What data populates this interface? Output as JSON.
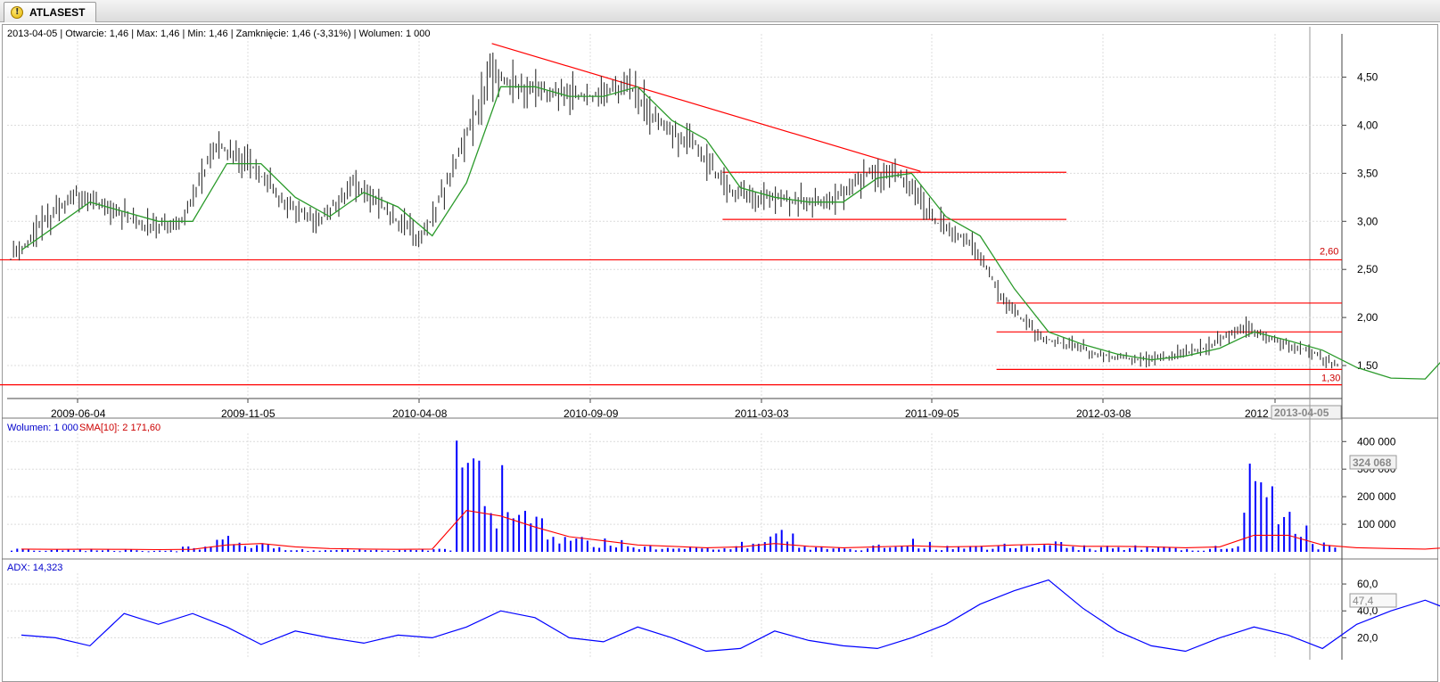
{
  "tab": {
    "title": "ATLASEST"
  },
  "info": {
    "ohlc": "2013-04-05 | Otwarcie: 1,46 | Max: 1,46 | Min: 1,46 | Zamknięcie: 1,46 (-3,31%)  | Wolumen: 1 000",
    "volume": "Wolumen: 1 000",
    "sma": "SMA[10]: 2 171,60",
    "adx": "ADX: 14,323"
  },
  "colors": {
    "bars": "#303030",
    "sma": "#2a9a2a",
    "lines": "#ff0000",
    "volume": "#0000ff",
    "volume_sma": "#ff0000",
    "adx": "#0000ff",
    "grid": "#dcdcdc"
  },
  "chart_data": [
    {
      "type": "line",
      "panel": "price",
      "x_tick_labels": [
        "2009-06-04",
        "2009-11-05",
        "2010-04-08",
        "2010-09-09",
        "2011-03-03",
        "2011-09-05",
        "2012-03-08",
        "2012",
        "2013-04-05"
      ],
      "y_tick_labels": [
        "1,50",
        "2,00",
        "2,50",
        "3,00",
        "3,50",
        "4,00",
        "4,50"
      ],
      "ylim": [
        1.25,
        4.95
      ],
      "annotations": [
        "2,60",
        "1,30"
      ],
      "horizontal_lines": [
        {
          "y": 2.6,
          "from": "2009-03",
          "to": "2013-04",
          "label": "2,60"
        },
        {
          "y": 1.3,
          "from": "2009-03",
          "to": "2013-04",
          "label": "1,30"
        },
        {
          "y": 3.51,
          "from": "2010-12",
          "to": "2011-09"
        },
        {
          "y": 3.02,
          "from": "2010-12",
          "to": "2011-09"
        },
        {
          "y": 2.15,
          "from": "2011-08",
          "to": "2013-04"
        },
        {
          "y": 1.85,
          "from": "2011-08",
          "to": "2013-04"
        },
        {
          "y": 1.46,
          "from": "2011-08",
          "to": "2013-04"
        }
      ],
      "trend_line": {
        "from": [
          "2010-05",
          4.85
        ],
        "to": [
          "2011-05",
          3.52
        ]
      },
      "series": [
        {
          "style": "ohlc-bars",
          "x": [
            "2009-03",
            "2009-04",
            "2009-05",
            "2009-06",
            "2009-07",
            "2009-08",
            "2009-09",
            "2009-10",
            "2009-11",
            "2009-12",
            "2010-01",
            "2010-02",
            "2010-03",
            "2010-04",
            "2010-05",
            "2010-06",
            "2010-07",
            "2010-08",
            "2010-09",
            "2010-10",
            "2010-11",
            "2010-12",
            "2011-01",
            "2011-02",
            "2011-03",
            "2011-04",
            "2011-05",
            "2011-06",
            "2011-07",
            "2011-08",
            "2011-09",
            "2011-10",
            "2011-11",
            "2011-12",
            "2012-01",
            "2012-02",
            "2012-03",
            "2012-04",
            "2012-05",
            "2012-06",
            "2012-07",
            "2012-08",
            "2012-09",
            "2012-10",
            "2012-11",
            "2012-12",
            "2013-01",
            "2013-02",
            "2013-03",
            "2013-04"
          ],
          "values": [
            2.6,
            3.0,
            3.3,
            3.1,
            2.95,
            3.0,
            3.8,
            3.6,
            3.2,
            3.0,
            3.4,
            3.1,
            2.8,
            3.6,
            4.5,
            4.4,
            4.3,
            4.3,
            4.45,
            4.0,
            3.8,
            3.3,
            3.25,
            3.2,
            3.2,
            3.5,
            3.5,
            3.0,
            2.8,
            2.2,
            1.8,
            1.7,
            1.6,
            1.55,
            1.6,
            1.7,
            1.9,
            1.75,
            1.65,
            1.45,
            1.35,
            1.35,
            1.8,
            2.0,
            1.75,
            1.65,
            1.6,
            1.55,
            1.46,
            1.46
          ]
        },
        {
          "style": "sma-line",
          "values": [
            2.7,
            2.95,
            3.2,
            3.1,
            3.0,
            3.0,
            3.6,
            3.6,
            3.25,
            3.05,
            3.3,
            3.15,
            2.85,
            3.4,
            4.4,
            4.4,
            4.3,
            4.3,
            4.4,
            4.05,
            3.85,
            3.35,
            3.25,
            3.2,
            3.2,
            3.45,
            3.5,
            3.05,
            2.85,
            2.3,
            1.85,
            1.72,
            1.62,
            1.56,
            1.6,
            1.68,
            1.85,
            1.76,
            1.66,
            1.48,
            1.37,
            1.36,
            1.75,
            1.95,
            1.78,
            1.66,
            1.6,
            1.55,
            1.47,
            1.44
          ]
        }
      ]
    },
    {
      "type": "bar",
      "panel": "volume",
      "y_tick_labels": [
        "100 000",
        "200 000",
        "300 000",
        "400 000"
      ],
      "ylim": [
        0,
        430000
      ],
      "annotations": [
        "324 068"
      ],
      "x": [
        "2009-03",
        "2009-04",
        "2009-05",
        "2009-06",
        "2009-07",
        "2009-08",
        "2009-09",
        "2009-10",
        "2009-11",
        "2009-12",
        "2010-01",
        "2010-02",
        "2010-03",
        "2010-04",
        "2010-05",
        "2010-06",
        "2010-07",
        "2010-08",
        "2010-09",
        "2010-10",
        "2010-11",
        "2010-12",
        "2011-01",
        "2011-02",
        "2011-03",
        "2011-04",
        "2011-05",
        "2011-06",
        "2011-07",
        "2011-08",
        "2011-09",
        "2011-10",
        "2011-11",
        "2011-12",
        "2012-01",
        "2012-02",
        "2012-03",
        "2012-04",
        "2012-05",
        "2012-06",
        "2012-07",
        "2012-08",
        "2012-09",
        "2012-10",
        "2012-11",
        "2012-12",
        "2013-01",
        "2013-02",
        "2013-03",
        "2013-04"
      ],
      "series": [
        {
          "name": "Wolumen",
          "values": [
            12000,
            8000,
            10000,
            9000,
            6000,
            20000,
            60000,
            30000,
            12000,
            10000,
            9000,
            8000,
            15000,
            420000,
            280000,
            150000,
            60000,
            45000,
            25000,
            20000,
            15000,
            30000,
            80000,
            20000,
            15000,
            25000,
            40000,
            20000,
            25000,
            35000,
            45000,
            20000,
            25000,
            20000,
            15000,
            25000,
            390000,
            130000,
            35000,
            15000,
            12000,
            10000,
            40000,
            30000,
            25000,
            20000,
            15000,
            8000,
            6000,
            1000
          ]
        },
        {
          "name": "SMA[10]",
          "values": [
            10000,
            9000,
            9500,
            9000,
            8000,
            9000,
            25000,
            30000,
            18000,
            12000,
            10000,
            9000,
            10000,
            150000,
            130000,
            90000,
            55000,
            40000,
            25000,
            20000,
            15000,
            18000,
            30000,
            20000,
            15000,
            18000,
            22000,
            18000,
            20000,
            25000,
            28000,
            20000,
            20000,
            18000,
            15000,
            18000,
            60000,
            60000,
            25000,
            15000,
            12000,
            10000,
            18000,
            20000,
            18000,
            15000,
            12000,
            8000,
            5000,
            2200
          ]
        }
      ]
    },
    {
      "type": "line",
      "panel": "adx",
      "y_tick_labels": [
        "20,0",
        "40,0",
        "60,0"
      ],
      "ylim": [
        5,
        68
      ],
      "annotations": [
        "47,4"
      ],
      "x": [
        "2009-03",
        "2009-04",
        "2009-05",
        "2009-06",
        "2009-07",
        "2009-08",
        "2009-09",
        "2009-10",
        "2009-11",
        "2009-12",
        "2010-01",
        "2010-02",
        "2010-03",
        "2010-04",
        "2010-05",
        "2010-06",
        "2010-07",
        "2010-08",
        "2010-09",
        "2010-10",
        "2010-11",
        "2010-12",
        "2011-01",
        "2011-02",
        "2011-03",
        "2011-04",
        "2011-05",
        "2011-06",
        "2011-07",
        "2011-08",
        "2011-09",
        "2011-10",
        "2011-11",
        "2011-12",
        "2012-01",
        "2012-02",
        "2012-03",
        "2012-04",
        "2012-05",
        "2012-06",
        "2012-07",
        "2012-08",
        "2012-09",
        "2012-10",
        "2012-11",
        "2012-12",
        "2013-01",
        "2013-02",
        "2013-03",
        "2013-04"
      ],
      "series": [
        {
          "name": "ADX",
          "values": [
            22,
            20,
            14,
            38,
            30,
            38,
            28,
            15,
            25,
            20,
            16,
            22,
            20,
            28,
            40,
            35,
            20,
            17,
            28,
            20,
            10,
            12,
            25,
            18,
            14,
            12,
            20,
            30,
            45,
            55,
            63,
            42,
            25,
            14,
            10,
            20,
            28,
            22,
            12,
            30,
            40,
            48,
            38,
            20,
            20,
            35,
            25,
            15,
            14,
            17
          ]
        }
      ]
    }
  ]
}
